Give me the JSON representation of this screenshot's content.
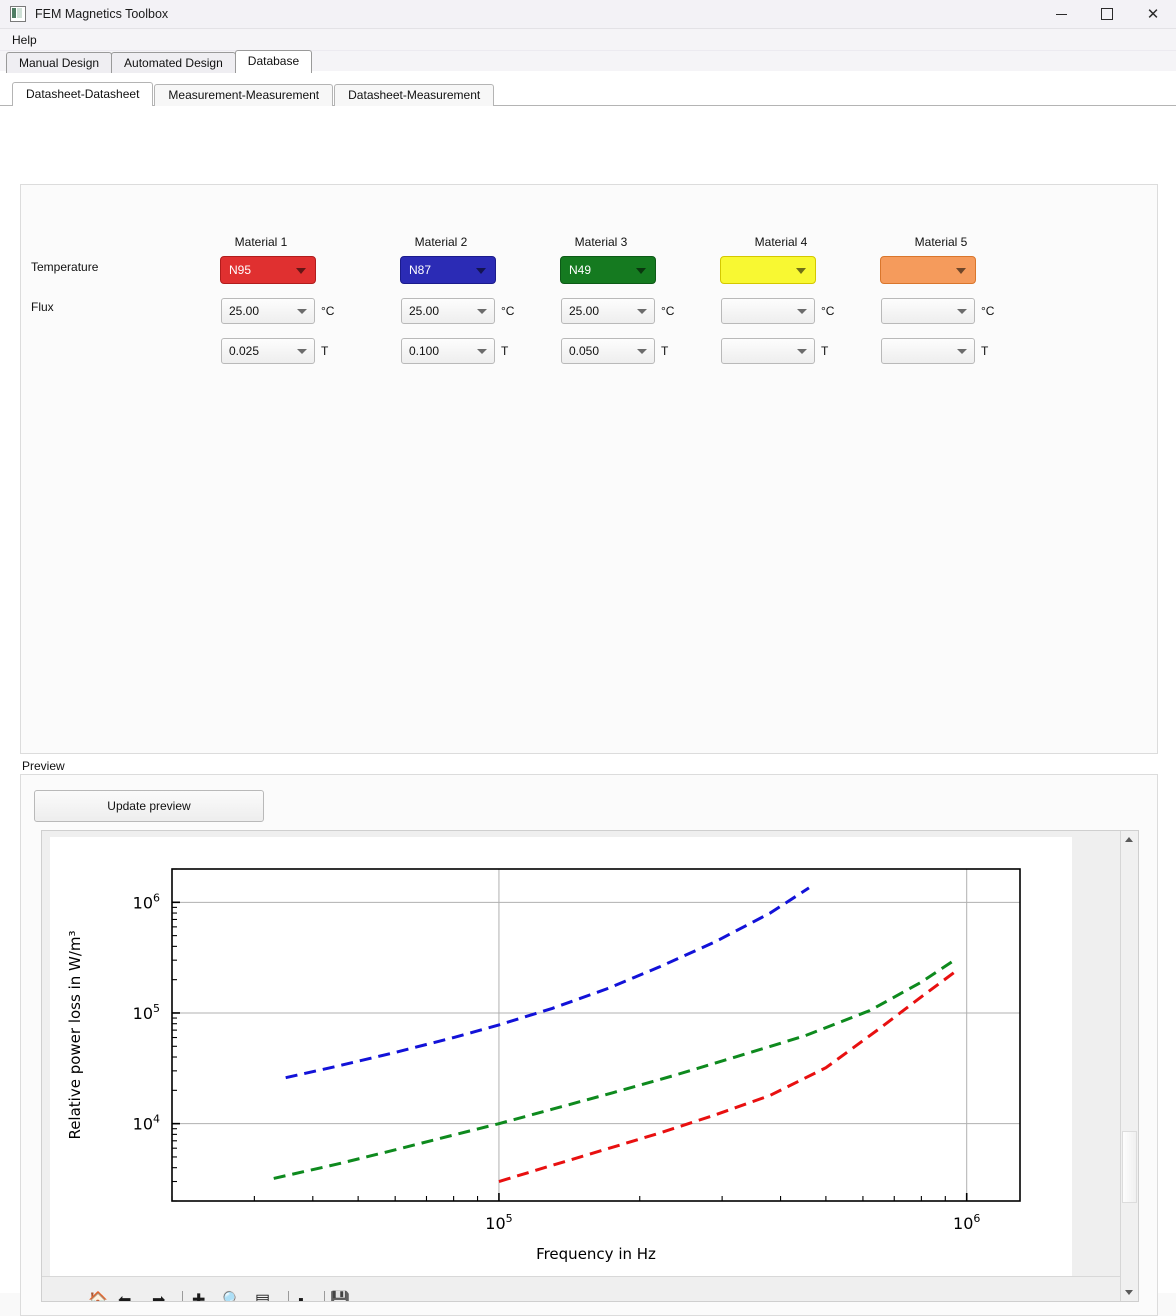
{
  "window": {
    "title": "FEM Magnetics Toolbox",
    "icon": "app-icon",
    "controls": {
      "minimize": "—",
      "maximize": "□",
      "close": "✕"
    }
  },
  "menubar": {
    "items": [
      {
        "label": "Help"
      }
    ]
  },
  "main_tabs": [
    {
      "label": "Manual Design",
      "active": false
    },
    {
      "label": "Automated Design",
      "active": false
    },
    {
      "label": "Database",
      "active": true
    }
  ],
  "sub_tabs": [
    {
      "label": "Datasheet-Datasheet",
      "active": true
    },
    {
      "label": "Measurement-Measurement",
      "active": false
    },
    {
      "label": "Datasheet-Measurement",
      "active": false
    }
  ],
  "material_panel": {
    "row_labels": {
      "temperature": "Temperature",
      "flux": "Flux"
    },
    "units": {
      "temperature": "°C",
      "flux": "T"
    },
    "columns": [
      {
        "header": "Material 1",
        "material": "N95",
        "color": "#e03030",
        "border": "#b11c1c",
        "temperature": "25.00",
        "flux": "0.025"
      },
      {
        "header": "Material 2",
        "material": "N87",
        "color": "#2b2bb5",
        "border": "#1b1b8c",
        "temperature": "25.00",
        "flux": "0.100"
      },
      {
        "header": "Material 3",
        "material": "N49",
        "color": "#157a20",
        "border": "#0d5a17",
        "temperature": "25.00",
        "flux": "0.050"
      },
      {
        "header": "Material 4",
        "material": "",
        "color": "#f8f832",
        "border": "#d4c800",
        "temperature": "",
        "flux": ""
      },
      {
        "header": "Material 5",
        "material": "",
        "color": "#f59b5c",
        "border": "#d9762c",
        "temperature": "",
        "flux": ""
      }
    ]
  },
  "preview": {
    "label": "Preview",
    "update_button": "Update preview",
    "toolbar_icons": [
      "home-icon",
      "back-arrow-icon",
      "forward-arrow-icon",
      "pan-icon",
      "zoom-icon",
      "configure-subplots-icon",
      "edit-axis-icon",
      "save-figure-icon"
    ]
  },
  "chart_data": {
    "type": "line",
    "title": "",
    "xlabel": "Frequency in Hz",
    "ylabel": "Relative power loss in W/m³",
    "xscale": "log",
    "yscale": "log",
    "xlim": [
      20000,
      1300000
    ],
    "ylim": [
      2000,
      2000000
    ],
    "xticks": [
      "10⁵",
      "10⁶"
    ],
    "xtick_values": [
      100000,
      1000000
    ],
    "yticks": [
      "10⁴",
      "10⁵",
      "10⁶"
    ],
    "ytick_values": [
      10000,
      100000,
      1000000
    ],
    "grid": true,
    "legend": "none",
    "linestyle": "dashed",
    "series": [
      {
        "name": "N95",
        "color": "#e81010",
        "x": [
          100000,
          130000,
          170000,
          220000,
          290000,
          380000,
          500000,
          650000,
          800000,
          950000
        ],
        "y": [
          3000,
          4200,
          5900,
          8200,
          12000,
          18000,
          32000,
          72000,
          140000,
          240000
        ]
      },
      {
        "name": "N87",
        "color": "#1212d8",
        "x": [
          35000,
          45000,
          60000,
          80000,
          100000,
          130000,
          170000,
          220000,
          290000,
          380000,
          460000
        ],
        "y": [
          26000,
          33000,
          44000,
          60000,
          78000,
          110000,
          165000,
          260000,
          440000,
          800000,
          1350000
        ]
      },
      {
        "name": "N49",
        "color": "#0e8a1e",
        "x": [
          33000,
          45000,
          60000,
          80000,
          100000,
          130000,
          175000,
          235000,
          320000,
          450000,
          620000,
          800000,
          930000
        ],
        "y": [
          3200,
          4300,
          5800,
          7900,
          10000,
          13500,
          19000,
          27000,
          40000,
          62000,
          105000,
          190000,
          290000
        ]
      }
    ]
  }
}
